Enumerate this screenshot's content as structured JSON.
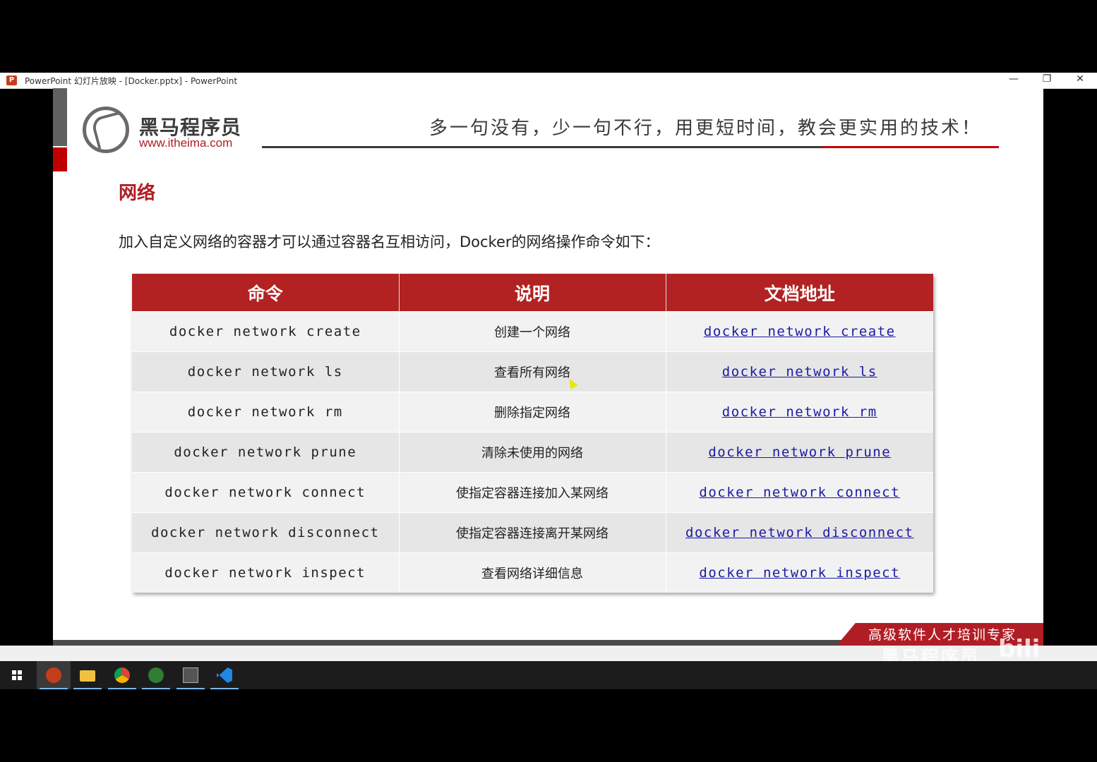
{
  "window": {
    "app_icon_letter": "P",
    "title": "PowerPoint 幻灯片放映 - [Docker.pptx] - PowerPoint",
    "min_icon": "—",
    "restore_icon": "❐",
    "close_icon": "✕"
  },
  "slide": {
    "logo": {
      "name": "黑马程序员",
      "url": "www.itheima.com"
    },
    "slogan": "多一句没有，少一句不行，用更短时间，教会更实用的技术！",
    "section_title": "网络",
    "intro": "加入自定义网络的容器才可以通过容器名互相访问，Docker的网络操作命令如下：",
    "table": {
      "headers": [
        "命令",
        "说明",
        "文档地址"
      ],
      "rows": [
        {
          "cmd": "docker network create",
          "desc": "创建一个网络",
          "link": "docker network create"
        },
        {
          "cmd": "docker network ls",
          "desc": "查看所有网络",
          "link": "docker network ls"
        },
        {
          "cmd": "docker network rm",
          "desc": "删除指定网络",
          "link": "docker network rm"
        },
        {
          "cmd": "docker network prune",
          "desc": "清除未使用的网络",
          "link": "docker network prune"
        },
        {
          "cmd": "docker network connect",
          "desc": "使指定容器连接加入某网络",
          "link": "docker network connect"
        },
        {
          "cmd": "docker network disconnect",
          "desc": "使指定容器连接离开某网络",
          "link": "docker network disconnect"
        },
        {
          "cmd": "docker network inspect",
          "desc": "查看网络详细信息",
          "link": "docker network inspect"
        }
      ]
    },
    "bottom_banner": "高级软件人才培训专家"
  },
  "watermark": {
    "text": "黑马程序员",
    "bili": "bili"
  },
  "taskbar": {
    "items": [
      "windows-start",
      "powerpoint",
      "file-explorer",
      "chrome",
      "hbuilder",
      "terminal",
      "vscode"
    ],
    "active": "powerpoint",
    "accent_color": "#76b9ed"
  },
  "colors": {
    "brand_red": "#b01d24",
    "table_header": "#b22222",
    "link": "#1a1aa6"
  }
}
